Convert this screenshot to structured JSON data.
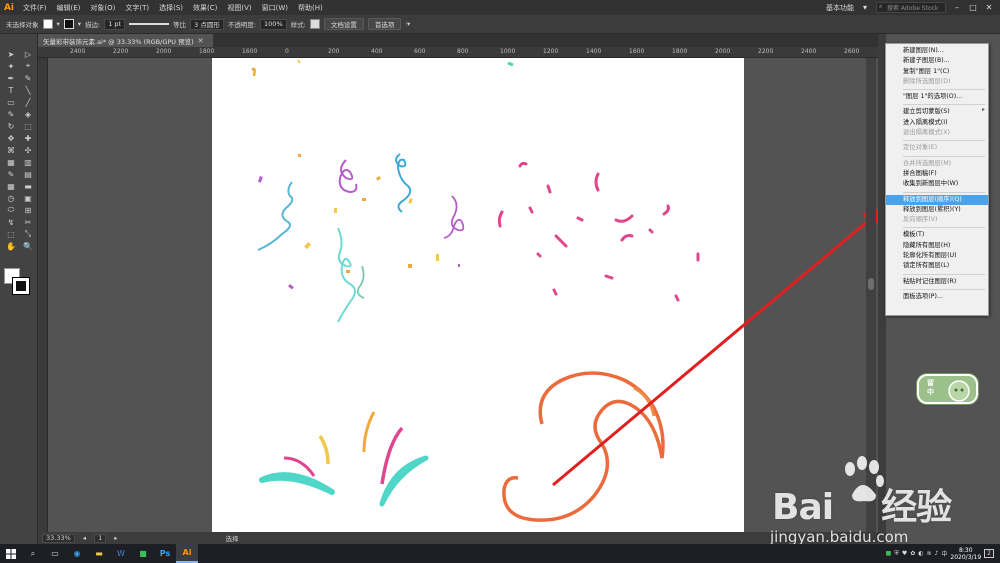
{
  "app": {
    "logo": "Ai",
    "menu": [
      "文件(F)",
      "编辑(E)",
      "对象(O)",
      "文字(T)",
      "选择(S)",
      "效果(C)",
      "视图(V)",
      "窗口(W)",
      "帮助(H)"
    ],
    "workspace": "基本功能",
    "search_placeholder": "搜索 Adobe Stock"
  },
  "controlbar": {
    "selection": "未选择对象",
    "stroke_label": "描边:",
    "stroke_value": "1 pt",
    "profile_label": "等比",
    "brush_label": "3 点圆形",
    "opacity_label": "不透明度:",
    "opacity_value": "100%",
    "style_label": "样式:",
    "doc_settings_btn": "文档设置",
    "prefs_btn": "首选项"
  },
  "document": {
    "tab_title": "矢量彩带装饰元素.ai* @ 33.33% (RGB/GPU 预览)",
    "close_symbol": "✕"
  },
  "rulers": {
    "top": [
      "2400",
      "2200",
      "2000",
      "1800",
      "1600",
      "0",
      "200",
      "400",
      "600",
      "800",
      "1000",
      "1200",
      "1400",
      "1600",
      "1800",
      "2000",
      "2200",
      "2400",
      "2600"
    ]
  },
  "status": {
    "zoom": "33.33%",
    "artboard": "1",
    "tool": "选择"
  },
  "context_menu": {
    "items": [
      {
        "label": "新建图层(N)...",
        "state": "enabled"
      },
      {
        "label": "新建子图层(B)...",
        "state": "enabled"
      },
      {
        "label": "复制\"图层 1\"(C)",
        "state": "enabled"
      },
      {
        "label": "删除所选图层(D)",
        "state": "disabled"
      },
      {
        "sep": true
      },
      {
        "label": "\"图层 1\"的选项(O)...",
        "state": "enabled"
      },
      {
        "sep": true
      },
      {
        "label": "建立剪切蒙版(S)",
        "state": "enabled"
      },
      {
        "label": "进入隔离模式(I)",
        "state": "enabled"
      },
      {
        "label": "退出隔离模式(X)",
        "state": "disabled"
      },
      {
        "sep": true
      },
      {
        "label": "定位对象(E)",
        "state": "disabled"
      },
      {
        "sep": true
      },
      {
        "label": "合并所选图层(M)",
        "state": "disabled"
      },
      {
        "label": "拼合图稿(F)",
        "state": "enabled"
      },
      {
        "label": "收集到新图层中(W)",
        "state": "enabled"
      },
      {
        "sep": true
      },
      {
        "label": "释放到图层(顺序)(Q)",
        "state": "highlight"
      },
      {
        "label": "释放到图层(累积)(Y)",
        "state": "enabled"
      },
      {
        "label": "反向顺序(V)",
        "state": "disabled"
      },
      {
        "sep": true
      },
      {
        "label": "模板(T)",
        "state": "enabled"
      },
      {
        "label": "隐藏所有图层(H)",
        "state": "enabled"
      },
      {
        "label": "轮廓化所有图层(U)",
        "state": "enabled"
      },
      {
        "label": "锁定所有图层(L)",
        "state": "enabled"
      },
      {
        "sep": true
      },
      {
        "label": "粘贴时记住图层(R)",
        "state": "enabled"
      },
      {
        "sep": true
      },
      {
        "label": "面板选项(P)...",
        "state": "enabled"
      }
    ]
  },
  "badge": {
    "line1": "留",
    "line2": "中"
  },
  "watermark": {
    "main": "Bai",
    "main2": "经验",
    "sub": "jingyan.baidu.com"
  },
  "taskbar": {
    "time": "8:30",
    "date": "2020/3/19",
    "notif_count": "2"
  },
  "colors": {
    "accent": "#ff9a00",
    "highlight": "#4aa3ea",
    "arrow": "#e02020",
    "ribbon_cyan": "#4fd6c8",
    "ribbon_magenta": "#e0468e",
    "ribbon_orange": "#ec6b3c",
    "ribbon_purple": "#b55cc8",
    "ribbon_yellow": "#f2c84b"
  }
}
